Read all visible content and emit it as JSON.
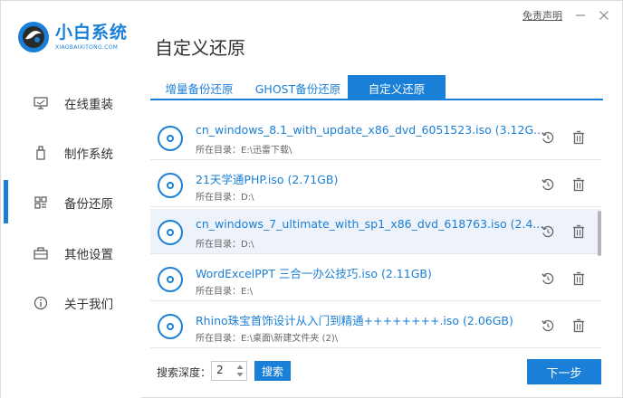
{
  "app": {
    "title": "小白系统",
    "subtitle": "XIAOBAIXITONG.COM"
  },
  "window": {
    "disclaimer": "免责声明"
  },
  "page_title": "自定义还原",
  "sidebar": {
    "items": [
      {
        "label": "在线重装",
        "icon": "monitor-icon"
      },
      {
        "label": "制作系统",
        "icon": "usb-icon"
      },
      {
        "label": "备份还原",
        "icon": "grid-icon",
        "active": true
      },
      {
        "label": "其他设置",
        "icon": "briefcase-icon"
      },
      {
        "label": "关于我们",
        "icon": "info-icon"
      }
    ]
  },
  "tabs": [
    {
      "label": "增量备份还原"
    },
    {
      "label": "GHOST备份还原"
    },
    {
      "label": "自定义还原",
      "active": true
    }
  ],
  "files": [
    {
      "name": "cn_windows_8.1_with_update_x86_dvd_6051523.iso (3.12G...",
      "dir": "所在目录：E:\\迅雷下载\\"
    },
    {
      "name": "21天学通PHP.iso (2.71GB)",
      "dir": "所在目录：D:\\"
    },
    {
      "name": "cn_windows_7_ultimate_with_sp1_x86_dvd_618763.iso (2.4...",
      "dir": "所在目录：D:\\",
      "highlight": true
    },
    {
      "name": "WordExcelPPT 三合一办公技巧.iso (2.11GB)",
      "dir": "所在目录：E:\\"
    },
    {
      "name": "Rhino珠宝首饰设计从入门到精通++++++++.iso (2.06GB)",
      "dir": "所在目录：E:\\桌面\\新建文件夹 (2)\\"
    }
  ],
  "footer": {
    "depth_label": "搜索深度：",
    "depth_value": "2",
    "search_label": "搜索",
    "next_label": "下一步"
  },
  "colors": {
    "accent": "#1a7fd6",
    "row_highlight": "#eef3fb"
  }
}
